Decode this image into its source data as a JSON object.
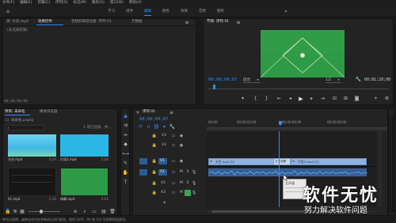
{
  "menu": {
    "items": [
      "文件(F)",
      "编辑(E)",
      "剪辑(C)",
      "序列(S)",
      "标记(M)",
      "图形(G)",
      "窗口(W)",
      "帮助(H)"
    ]
  },
  "workspaces": {
    "tabs": [
      "学习",
      "组件",
      "编辑",
      "颜色",
      "效果",
      "音频",
      "图形"
    ],
    "active": "编辑"
  },
  "source_panel": {
    "tabs": [
      "源: 片段.mp4",
      "效果控件",
      "音频剪辑混合器: 序列 01",
      "元数据"
    ],
    "placeholder": "(未选择剪辑)",
    "timecode": "00;00;00;00"
  },
  "program_monitor": {
    "tab": "节目: 序列 01",
    "timecode": "00;00;04;07",
    "fit": "适合",
    "resolution": "1/2",
    "duration": "00;01;20;00"
  },
  "project_panel": {
    "tabs": [
      "项目: 未命名",
      "媒体浏览器"
    ],
    "name": "未命名.prproj",
    "selection": "1 项已选择，共...",
    "clips": [
      {
        "name": "天空.mp4",
        "duration": "4;24"
      },
      {
        "name": "片段2.mp4",
        "duration": "5;00"
      },
      {
        "name": "01.mp4",
        "duration": "2;10"
      },
      {
        "name": "绿幕.mp4",
        "duration": "4;01"
      }
    ]
  },
  "timeline": {
    "tab": "序列 01",
    "timecode": "00;00;04;07",
    "ruler": [
      "00;00",
      "00;00;02;00",
      "00;00;04;00",
      "00;00;06;00"
    ],
    "video_tracks": [
      "V3",
      "V2",
      "V1"
    ],
    "audio_tracks": [
      "A1",
      "A2",
      "A3"
    ],
    "clips": {
      "v1_left": "天空.mp4 [V]",
      "v1_right": "片段2.mp4 [V]",
      "v1_transition": "交叉溶解",
      "popup": "主声道"
    }
  },
  "status_bar": "单击以选择，或单击空白处并拖动以进行框选。使用 Shift、Alt 和 Ctrl 可获得其他选项。",
  "watermark": {
    "title": "软件无忧",
    "subtitle": "努力解决软件问题"
  },
  "colors": {
    "accent": "#2f8cff",
    "clip_video": "#8fb3e0",
    "clip_video_dark": "#5b7fb3",
    "audio_clip": "#3f9e4d",
    "green_screen": "#2c9a47"
  }
}
